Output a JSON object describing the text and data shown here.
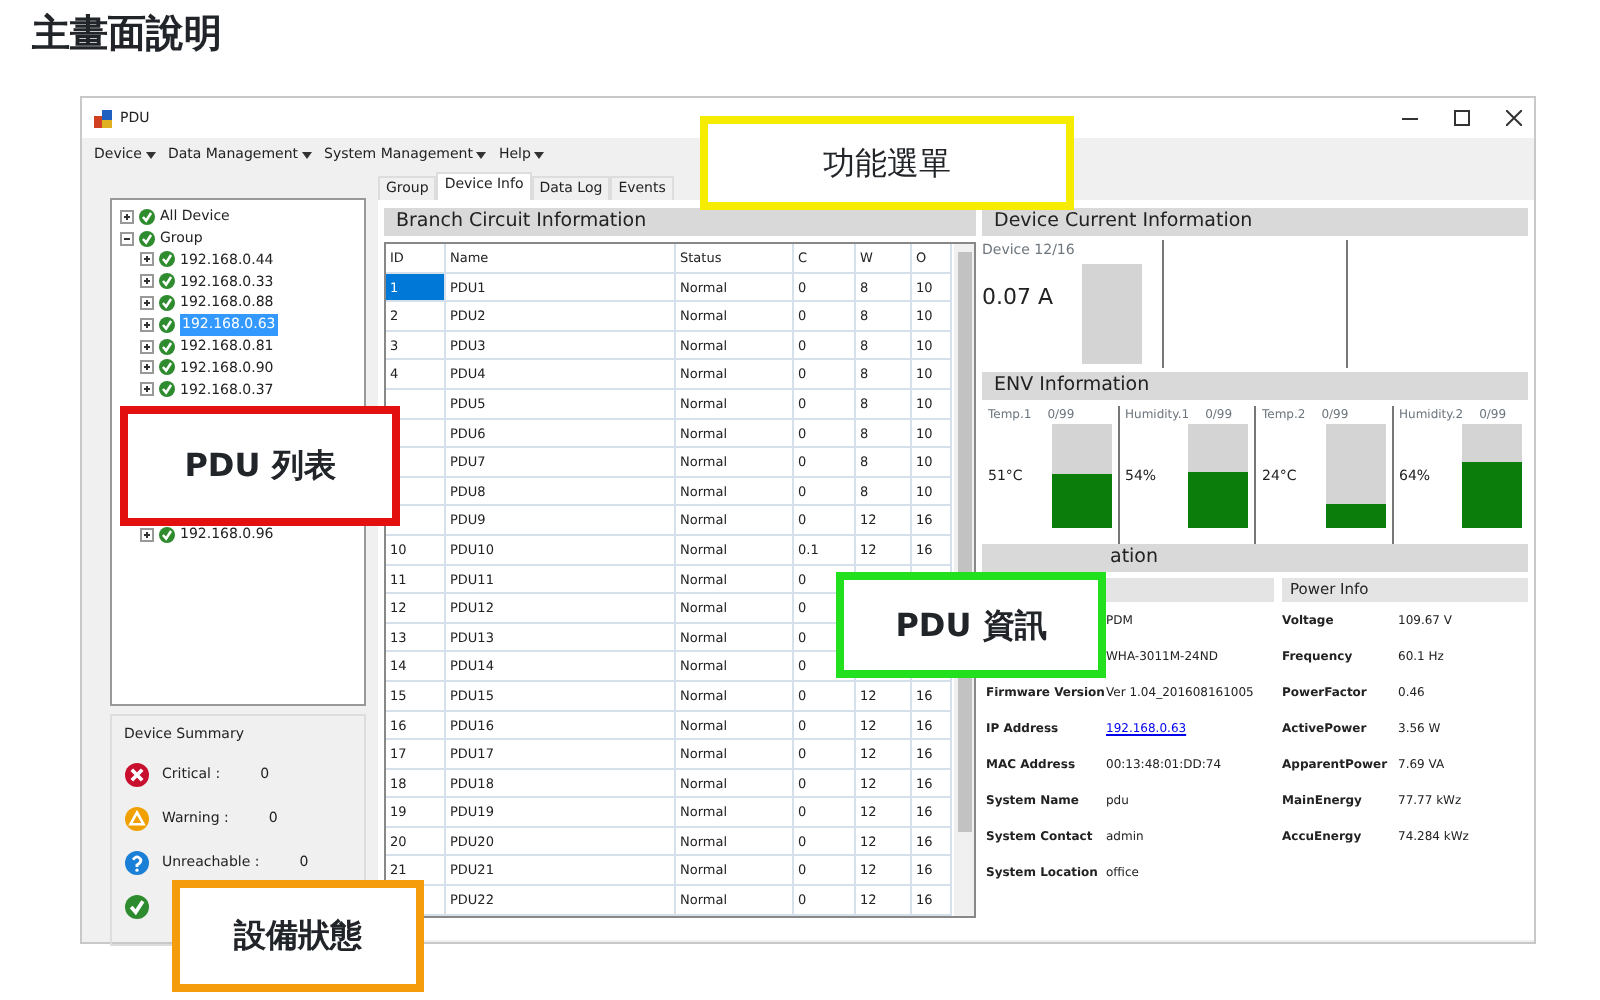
{
  "page_title": "主畫面說明",
  "window": {
    "title": "PDU"
  },
  "menu": [
    "Device",
    "Data Management",
    "System Management",
    "Help"
  ],
  "tree": [
    {
      "label": "All Device",
      "expanded": false,
      "selected": false
    },
    {
      "label": "Group",
      "expanded": true,
      "selected": false,
      "children": [
        {
          "label": "192.168.0.44",
          "expanded": false,
          "selected": false
        },
        {
          "label": "192.168.0.33",
          "expanded": false,
          "selected": false
        },
        {
          "label": "192.168.0.88",
          "expanded": false,
          "selected": false
        },
        {
          "label": "192.168.0.63",
          "expanded": false,
          "selected": true
        },
        {
          "label": "192.168.0.81",
          "expanded": false,
          "selected": false
        },
        {
          "label": "192.168.0.90",
          "expanded": false,
          "selected": false
        },
        {
          "label": "192.168.0.37",
          "expanded": false,
          "selected": false
        },
        {
          "label": "192.168.0.96",
          "expanded": false,
          "selected": false
        }
      ]
    }
  ],
  "device_summary": {
    "title": "Device Summary",
    "items": [
      {
        "kind": "critical",
        "label": "Critical :",
        "count": "0"
      },
      {
        "kind": "warning",
        "label": "Warning :",
        "count": "0"
      },
      {
        "kind": "unreachable",
        "label": "Unreachable :",
        "count": "0"
      },
      {
        "kind": "normal"
      }
    ]
  },
  "tabs": [
    {
      "label": "Group",
      "selected": false
    },
    {
      "label": "Device Info",
      "selected": true
    },
    {
      "label": "Data Log",
      "selected": false
    },
    {
      "label": "Events",
      "selected": false
    }
  ],
  "branch": {
    "title": "Branch Circuit Information",
    "columns": [
      "ID",
      "Name",
      "Status",
      "C",
      "W",
      "O"
    ],
    "rows": [
      {
        "id": "1",
        "name": "PDU1",
        "status": "Normal",
        "c": "0",
        "w": "8",
        "o": "10",
        "selected": true
      },
      {
        "id": "2",
        "name": "PDU2",
        "status": "Normal",
        "c": "0",
        "w": "8",
        "o": "10",
        "selected": false
      },
      {
        "id": "3",
        "name": "PDU3",
        "status": "Normal",
        "c": "0",
        "w": "8",
        "o": "10",
        "selected": false
      },
      {
        "id": "4",
        "name": "PDU4",
        "status": "Normal",
        "c": "0",
        "w": "8",
        "o": "10",
        "selected": false
      },
      {
        "name": "PDU5",
        "status": "Normal",
        "c": "0",
        "w": "8",
        "o": "10",
        "selected": false
      },
      {
        "name": "PDU6",
        "status": "Normal",
        "c": "0",
        "w": "8",
        "o": "10",
        "selected": false
      },
      {
        "name": "PDU7",
        "status": "Normal",
        "c": "0",
        "w": "8",
        "o": "10",
        "selected": false
      },
      {
        "name": "PDU8",
        "status": "Normal",
        "c": "0",
        "w": "8",
        "o": "10",
        "selected": false
      },
      {
        "name": "PDU9",
        "status": "Normal",
        "c": "0",
        "w": "12",
        "o": "16",
        "selected": false
      },
      {
        "id": "10",
        "name": "PDU10",
        "status": "Normal",
        "c": "0.1",
        "w": "12",
        "o": "16",
        "selected": false
      },
      {
        "id": "11",
        "name": "PDU11",
        "status": "Normal",
        "c": "0",
        "selected": false
      },
      {
        "id": "12",
        "name": "PDU12",
        "status": "Normal",
        "c": "0",
        "selected": false
      },
      {
        "id": "13",
        "name": "PDU13",
        "status": "Normal",
        "c": "0",
        "selected": false
      },
      {
        "id": "14",
        "name": "PDU14",
        "status": "Normal",
        "c": "0",
        "selected": false
      },
      {
        "id": "15",
        "name": "PDU15",
        "status": "Normal",
        "c": "0",
        "w": "12",
        "o": "16",
        "selected": false
      },
      {
        "id": "16",
        "name": "PDU16",
        "status": "Normal",
        "c": "0",
        "w": "12",
        "o": "16",
        "selected": false
      },
      {
        "id": "17",
        "name": "PDU17",
        "status": "Normal",
        "c": "0",
        "w": "12",
        "o": "16",
        "selected": false
      },
      {
        "id": "18",
        "name": "PDU18",
        "status": "Normal",
        "c": "0",
        "w": "12",
        "o": "16",
        "selected": false
      },
      {
        "id": "19",
        "name": "PDU19",
        "status": "Normal",
        "c": "0",
        "w": "12",
        "o": "16",
        "selected": false
      },
      {
        "id": "20",
        "name": "PDU20",
        "status": "Normal",
        "c": "0",
        "w": "12",
        "o": "16",
        "selected": false
      },
      {
        "id": "21",
        "name": "PDU21",
        "status": "Normal",
        "c": "0",
        "w": "12",
        "o": "16",
        "selected": false
      },
      {
        "name": "PDU22",
        "status": "Normal",
        "c": "0",
        "w": "12",
        "o": "16",
        "selected": false
      }
    ]
  },
  "device_current": {
    "title": "Device Current Information",
    "label": "Device 12/16",
    "value": "0.07 A",
    "level": 0
  },
  "env": {
    "title": "ENV Information",
    "sensors": [
      {
        "name": "Temp.1",
        "range": "0/99",
        "value": "51°C",
        "level": 0.51
      },
      {
        "name": "Humidity.1",
        "range": "0/99",
        "value": "54%",
        "level": 0.54
      },
      {
        "name": "Temp.2",
        "range": "0/99",
        "value": "24°C",
        "level": 0.24
      },
      {
        "name": "Humidity.2",
        "range": "0/99",
        "value": "64%",
        "level": 0.64
      }
    ]
  },
  "pdu_info": {
    "title": "ation",
    "device_info": [
      {
        "value": "PDM"
      },
      {
        "value": "WHA-3011M-24ND"
      },
      {
        "label": "Firmware Version",
        "value": "Ver 1.04_201608161005"
      },
      {
        "label": "IP Address",
        "value": "192.168.0.63",
        "kind": "link"
      },
      {
        "label": "MAC Address",
        "value": "00:13:48:01:DD:74"
      },
      {
        "label": "System Name",
        "value": "pdu"
      },
      {
        "label": "System Contact",
        "value": "admin"
      },
      {
        "label": "System Location",
        "value": "office"
      }
    ],
    "power_info": {
      "title": "Power Info",
      "rows": [
        {
          "label": "Voltage",
          "value": "109.67 V"
        },
        {
          "label": "Frequency",
          "value": "60.1 Hz"
        },
        {
          "label": "PowerFactor",
          "value": "0.46"
        },
        {
          "label": "ActivePower",
          "value": "3.56 W"
        },
        {
          "label": "ApparentPower",
          "value": "7.69 VA"
        },
        {
          "label": "MainEnergy",
          "value": "77.77 kWz"
        },
        {
          "label": "AccuEnergy",
          "value": "74.284 kWz"
        }
      ]
    }
  },
  "callouts": [
    {
      "text": "功能選單",
      "color": "#f5ec00"
    },
    {
      "text": "PDU 列表",
      "color": "#e31010"
    },
    {
      "text": "PDU 資訊",
      "color": "#22e01e"
    },
    {
      "text": "設備狀態",
      "color": "#f59c0c"
    }
  ]
}
